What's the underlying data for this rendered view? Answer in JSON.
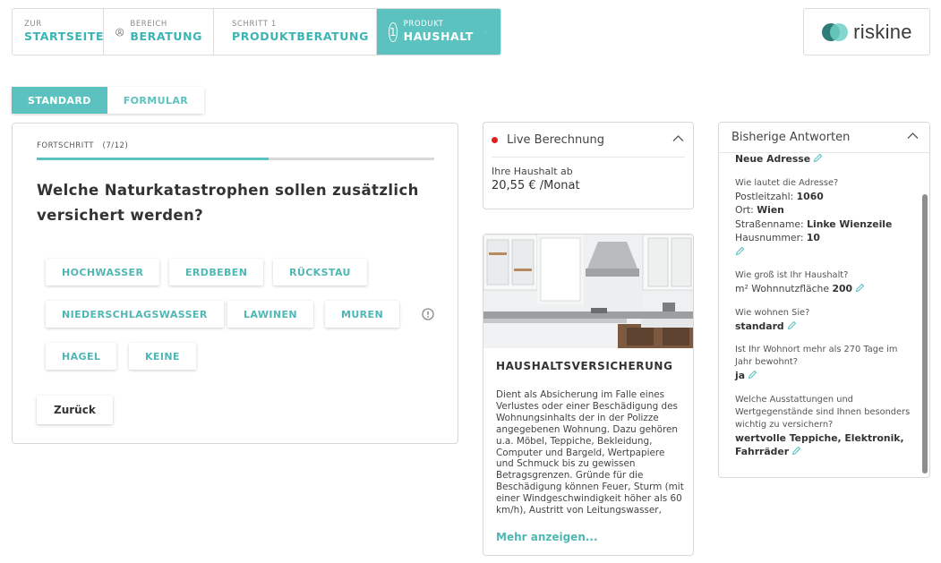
{
  "nav": {
    "items": [
      {
        "small": "Zur",
        "big": "Startseite"
      },
      {
        "small": "Bereich",
        "big": "Beratung",
        "icon": "user-circle-icon"
      },
      {
        "small": "Schritt 1",
        "big": "Produktberatung",
        "icon": "advice-icon"
      },
      {
        "small": "Produkt",
        "big": "Haushalt",
        "number": "1",
        "icon": "chevron-down-icon"
      }
    ]
  },
  "logo": {
    "text": "riskine"
  },
  "tabs": {
    "standard": "Standard",
    "formular": "Formular"
  },
  "question_card": {
    "progress_label": "Fortschritt",
    "progress_count": "(7/12)",
    "progress_fraction": 0.583,
    "question": "Welche Naturkatastrophen sollen zusätzlich versichert werden?",
    "options": [
      "Hochwasser",
      "Erdbeben",
      "Rückstau",
      "Niederschlagswasser",
      "Lawinen",
      "Muren",
      "Hagel",
      "Keine"
    ],
    "back_label": "Zurück",
    "info_icon": "exclamation-circle-icon"
  },
  "live": {
    "title": "Live Berechnung",
    "subtitle": "Ihre Haushalt ab",
    "price": "20,55 €  /Monat",
    "status_color": "#e02020"
  },
  "product": {
    "title": "Haushaltsversicherung",
    "description": "Dient als Absicherung im Falle eines Verlustes oder einer Beschädigung des Wohnungsinhalts der in der Polizze angegebenen Wohnung. Dazu gehören u.a. Möbel, Teppiche, Bekleidung, Computer und Bargeld, Wertpapiere und Schmuck bis zu gewissen Betragsgrenzen. Gründe für die Beschädigung können Feuer, Sturm (mit einer Windgeschwindigkeit höher als 60 km/h), Austritt von Leitungswasser,",
    "more": "Mehr anzeigen..."
  },
  "answers": {
    "title": "Bisherige Antworten",
    "first_value": "Neue Adresse",
    "address_q": "Wie lautet die Adresse?",
    "plz_label": "Postleitzahl:",
    "plz_value": "1060",
    "ort_label": "Ort:",
    "ort_value": "Wien",
    "street_label": "Straßenname:",
    "street_value": "Linke Wienzeile",
    "nr_label": "Hausnummer:",
    "nr_value": "10",
    "size_q": "Wie groß ist Ihr Haushalt?",
    "size_label": "m² Wohnnutzfläche",
    "size_value": "200",
    "live_q": "Wie wohnen Sie?",
    "live_value": "standard",
    "days_q": "Ist Ihr Wohnort mehr als 270 Tage im Jahr bewohnt?",
    "days_value": "ja",
    "items_q": "Welche Ausstattungen und Wertgegenstände sind Ihnen besonders wichtig zu versichern?",
    "items_value": "wertvolle Teppiche, Elektronik, Fahrräder"
  },
  "colors": {
    "accent": "#5cc2bf",
    "accent_text": "#3cb4b4"
  }
}
